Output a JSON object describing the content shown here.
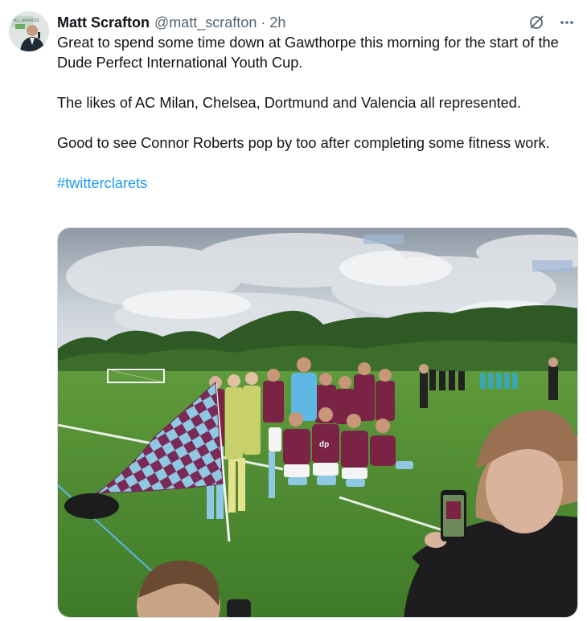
{
  "author": {
    "name": "Matt Scrafton",
    "handle": "@matt_scrafton",
    "separator": "·",
    "time": "2h",
    "avatar_badge": "ALL AWARDS"
  },
  "actions": {
    "grok_icon": "slash-circle-icon",
    "more_icon": "more-horizontal-icon"
  },
  "tweet": {
    "paragraph_1": "Great to spend some time down at Gawthorpe this morning for the start of the Dude Perfect International Youth Cup.",
    "paragraph_2": "The likes of AC Milan, Chelsea, Dortmund and Valencia all represented.",
    "paragraph_3": "Good to see Connor Roberts pop by too after completing some fitness work.",
    "hashtag": "#twitterclarets"
  },
  "media": {
    "kit_sponsor": "dp"
  },
  "colors": {
    "text": "#0f1419",
    "secondary": "#536471",
    "link": "#1d9bf0",
    "claret": "#7a2344",
    "sky_blue": "#86c5e0"
  }
}
